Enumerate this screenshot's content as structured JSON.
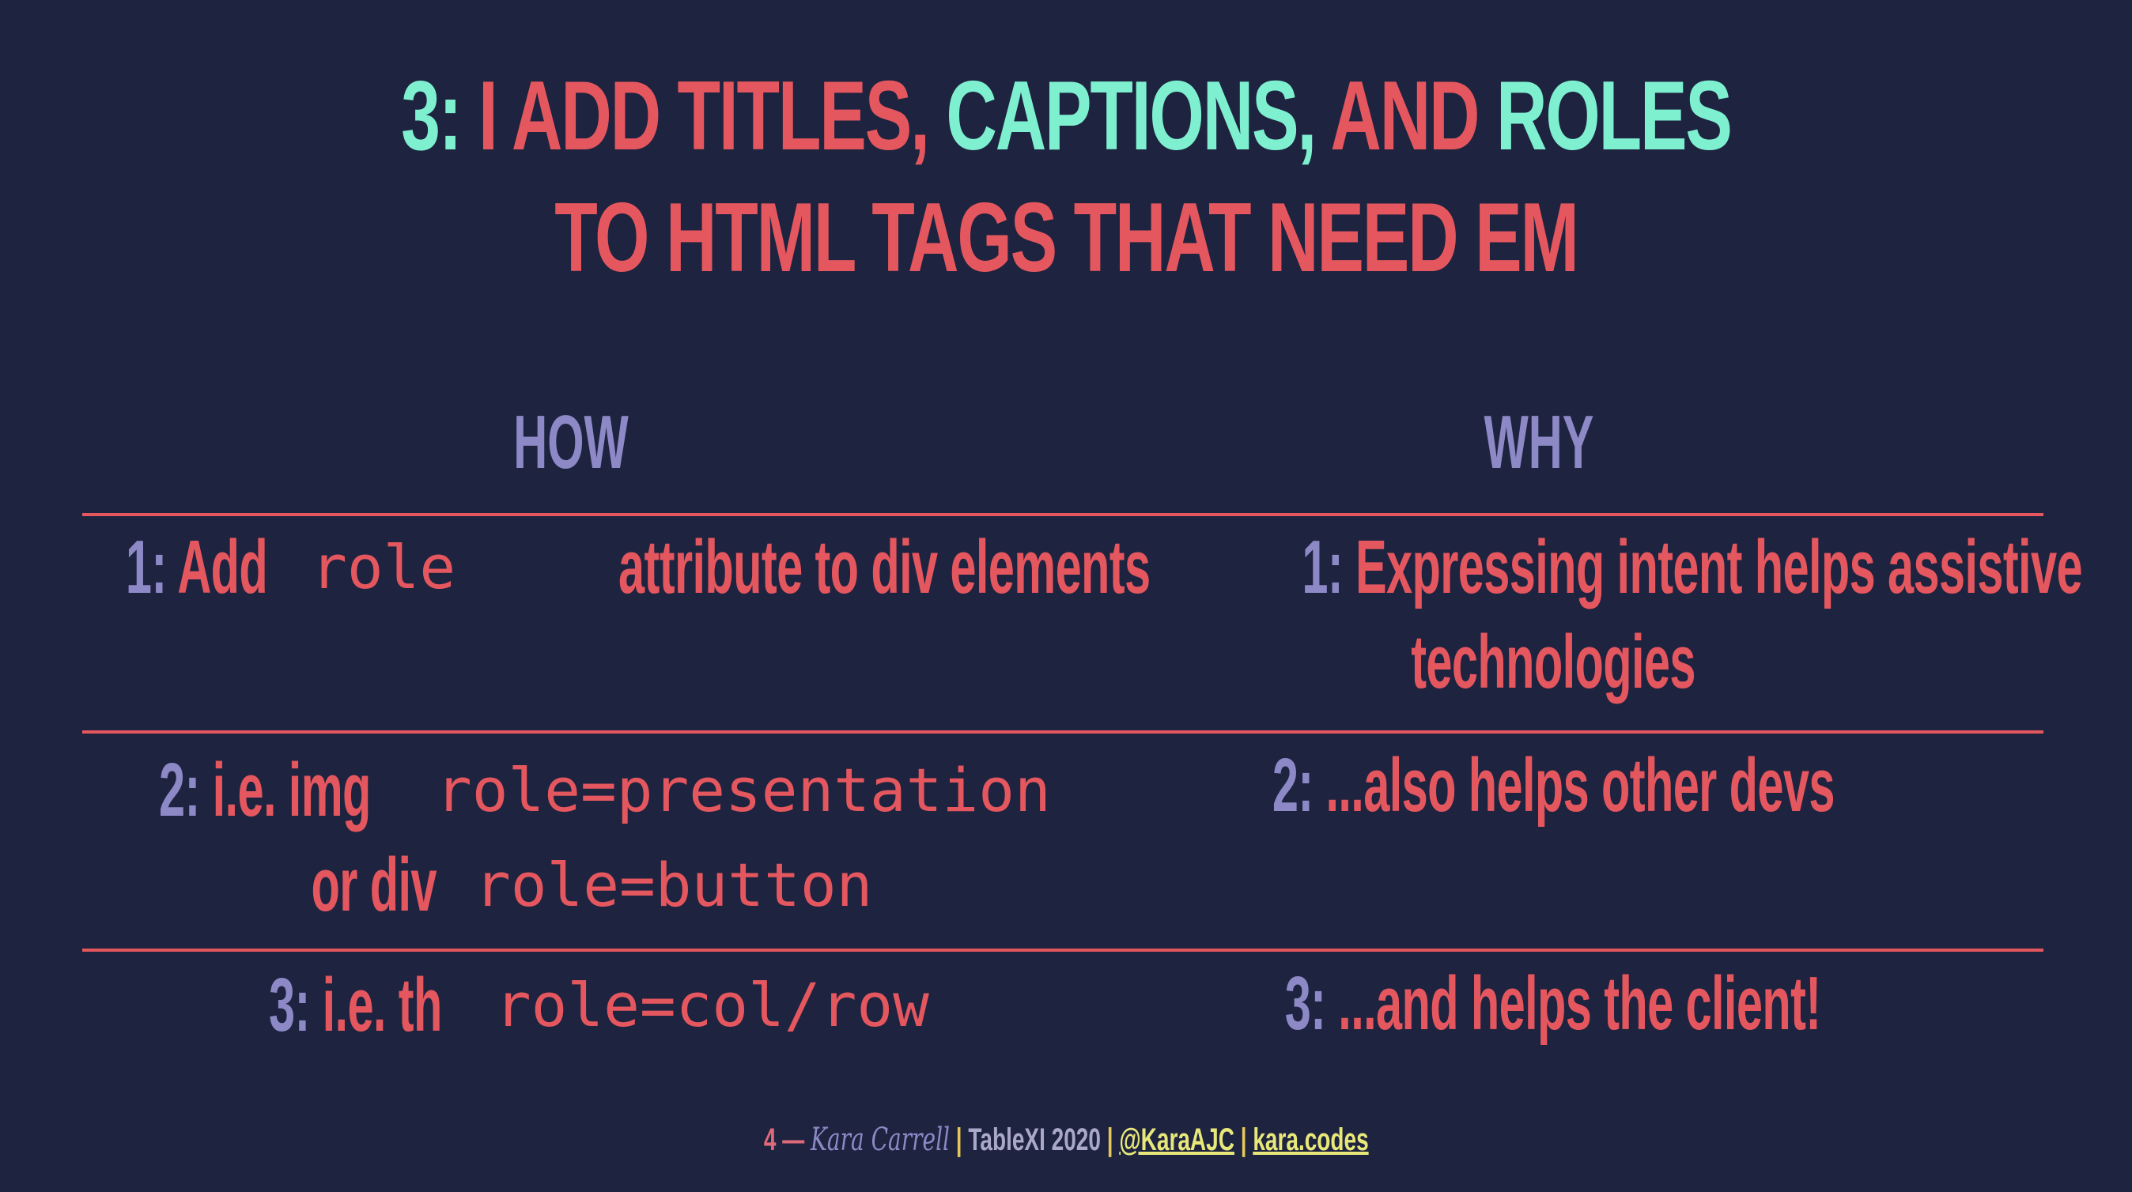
{
  "title": {
    "line1": {
      "prefix": "3: ",
      "part1": "I ADD TITLES, ",
      "part2": "CAPTIONS, ",
      "part3": "AND ",
      "part4": "ROLES"
    },
    "line2": "TO HTML TAGS THAT NEED EM"
  },
  "columns": {
    "how": "HOW",
    "why": "WHY"
  },
  "rows": [
    {
      "how": {
        "num": "1: ",
        "text_a": "Add ",
        "code_a": "role",
        "text_b": " attribute to div elements"
      },
      "why": {
        "num": "1: ",
        "text_a": "Expressing intent helps assistive",
        "text_b": "technologies"
      }
    },
    {
      "how": {
        "num": "2: ",
        "text_a": "i.e. img ",
        "code_a": "role=presentation",
        "text_b": "or div ",
        "code_b": "role=button"
      },
      "why": {
        "num": "2: ",
        "text_a": "...also helps other devs"
      }
    },
    {
      "how": {
        "num": "3: ",
        "text_a": "i.e. th ",
        "code_a": "role=col/row"
      },
      "why": {
        "num": "3: ",
        "text_a": "...and helps the client!"
      }
    }
  ],
  "footer": {
    "page": "4 — ",
    "author": "Kara Carrell",
    "sep": " | ",
    "event": "TableXI 2020",
    "handle": "@KaraAJC",
    "site": "kara.codes"
  },
  "colors": {
    "background": "#1e2340",
    "teal": "#7ef0d0",
    "red": "#e5575e",
    "lavender": "#8c89c6"
  }
}
